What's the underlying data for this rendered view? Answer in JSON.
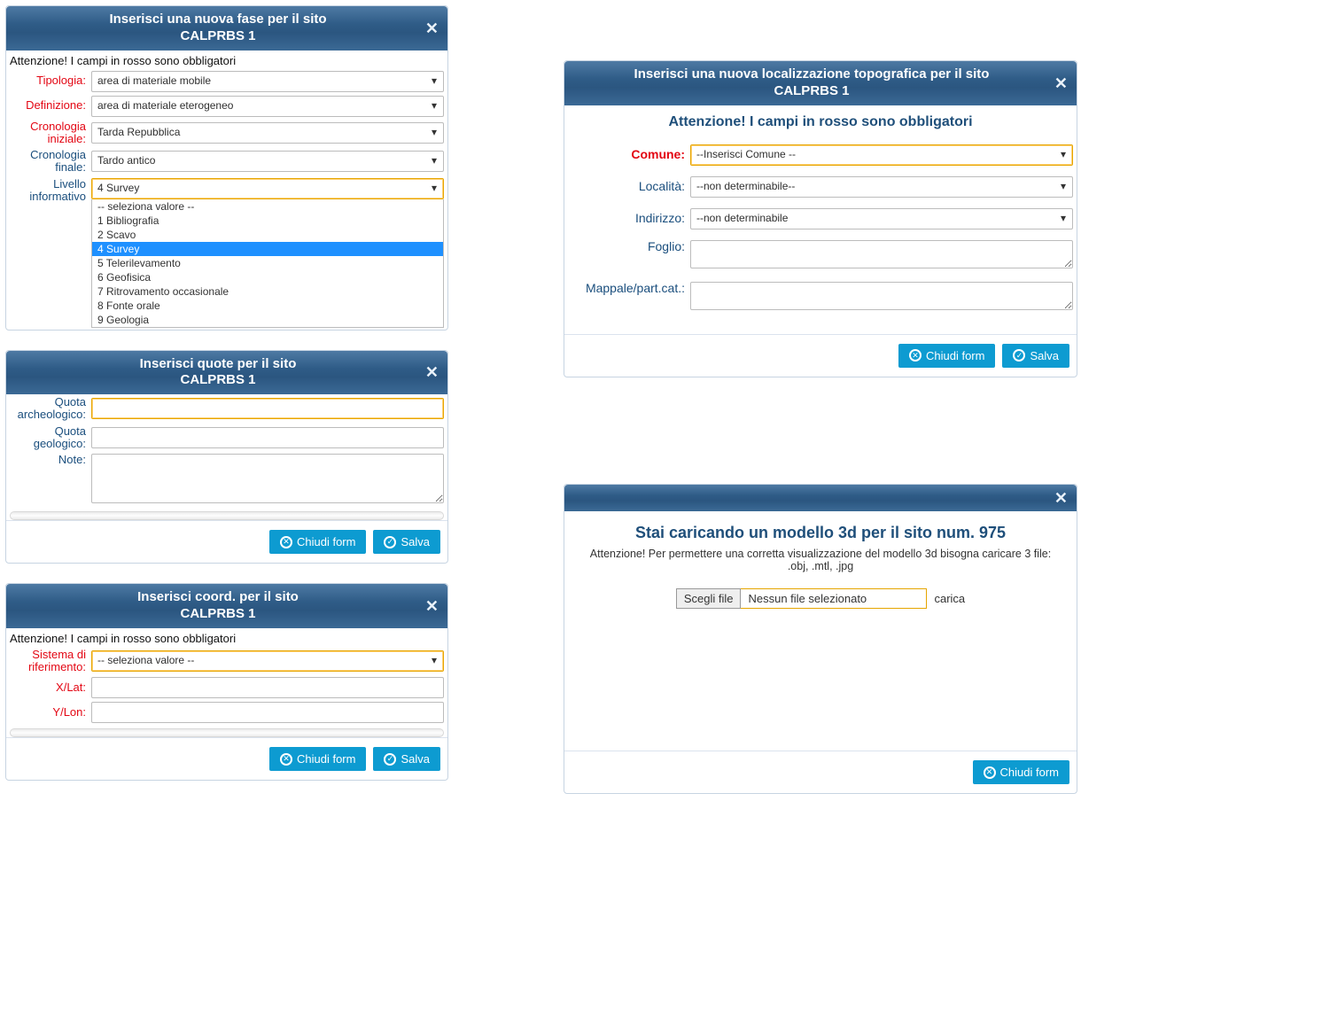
{
  "buttons": {
    "close": "Chiudi form",
    "save": "Salva"
  },
  "fase": {
    "title_line1": "Inserisci una nuova fase per il sito",
    "title_line2": "CALPRBS 1",
    "notice": "Attenzione! I campi in rosso sono obbligatori",
    "fields": {
      "tipologia": {
        "label": "Tipologia:",
        "value": "area di materiale mobile"
      },
      "definizione": {
        "label": "Definizione:",
        "value": "area di materiale eterogeneo"
      },
      "cron_iniziale": {
        "label1": "Cronologia",
        "label2": "iniziale:",
        "value": "Tarda Repubblica"
      },
      "cron_finale": {
        "label1": "Cronologia",
        "label2": "finale:",
        "value": "Tardo antico"
      },
      "livello": {
        "label1": "Livello",
        "label2": "informativo",
        "value": "4 Survey"
      }
    },
    "livello_options": [
      {
        "text": "-- seleziona valore --",
        "selected": false
      },
      {
        "text": "1 Bibliografia",
        "selected": false
      },
      {
        "text": "2 Scavo",
        "selected": false
      },
      {
        "text": "4 Survey",
        "selected": true
      },
      {
        "text": "5 Telerilevamento",
        "selected": false
      },
      {
        "text": "6 Geofisica",
        "selected": false
      },
      {
        "text": "7 Ritrovamento occasionale",
        "selected": false
      },
      {
        "text": "8 Fonte orale",
        "selected": false
      },
      {
        "text": "9 Geologia",
        "selected": false
      }
    ]
  },
  "quote": {
    "title_line1": "Inserisci quote per il sito",
    "title_line2": "CALPRBS 1",
    "fields": {
      "archeologico": {
        "label1": "Quota",
        "label2": "archeologico:"
      },
      "geologico": {
        "label1": "Quota",
        "label2": "geologico:"
      },
      "note": {
        "label": "Note:"
      }
    }
  },
  "coord": {
    "title_line1": "Inserisci coord. per il sito",
    "title_line2": "CALPRBS 1",
    "notice": "Attenzione! I campi in rosso sono obbligatori",
    "fields": {
      "sistema": {
        "label1": "Sistema di",
        "label2": "riferimento:",
        "value": "-- seleziona valore --"
      },
      "xlat": {
        "label": "X/Lat:"
      },
      "ylon": {
        "label": "Y/Lon:"
      }
    }
  },
  "loc": {
    "title_line1": "Inserisci una nuova localizzazione topografica per il sito",
    "title_line2": "CALPRBS 1",
    "subtitle": "Attenzione! I campi in rosso sono obbligatori",
    "fields": {
      "comune": {
        "label": "Comune:",
        "value": "--Inserisci Comune --"
      },
      "localita": {
        "label": "Località:",
        "value": "--non determinabile--"
      },
      "indirizzo": {
        "label": "Indirizzo:",
        "value": "--non determinabile"
      },
      "foglio": {
        "label": "Foglio:"
      },
      "mappale": {
        "label": "Mappale/part.cat.:"
      }
    }
  },
  "upload": {
    "title": "Stai caricando un modello 3d per il sito num. 975",
    "subtitle": "Attenzione! Per permettere una corretta visualizzazione del modello 3d bisogna caricare 3 file: .obj, .mtl, .jpg",
    "choose_btn": "Scegli file",
    "no_file": "Nessun file selezionato",
    "carica": "carica"
  }
}
